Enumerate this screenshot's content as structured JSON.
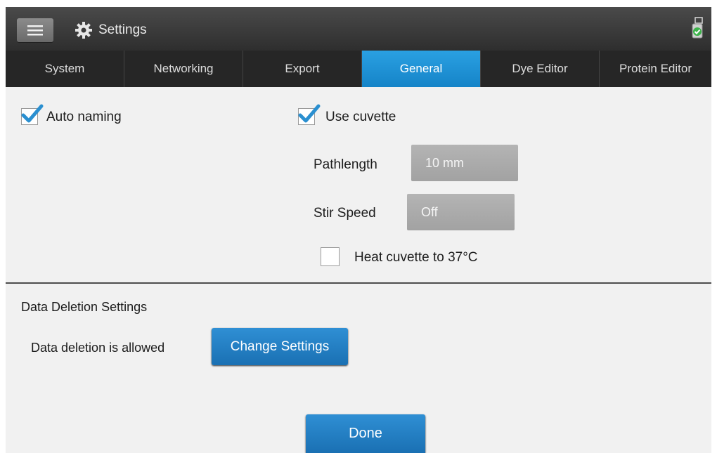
{
  "app": {
    "title": "Settings"
  },
  "tabs": [
    {
      "label": "System"
    },
    {
      "label": "Networking"
    },
    {
      "label": "Export"
    },
    {
      "label": "General",
      "active": true
    },
    {
      "label": "Dye Editor"
    },
    {
      "label": "Protein Editor"
    }
  ],
  "general": {
    "auto_naming": {
      "label": "Auto naming",
      "checked": true
    },
    "use_cuvette": {
      "label": "Use cuvette",
      "checked": true
    },
    "pathlength": {
      "label": "Pathlength",
      "value": "10 mm"
    },
    "stir_speed": {
      "label": "Stir Speed",
      "value": "Off"
    },
    "heat_cuvette": {
      "label": "Heat cuvette to 37°C",
      "checked": false
    }
  },
  "data_deletion": {
    "heading": "Data Deletion Settings",
    "status": "Data deletion is allowed",
    "change_button": "Change Settings"
  },
  "done_button": "Done",
  "colors": {
    "accent": "#1f86cc",
    "active_tab": "#1d8fd6",
    "check": "#2a8fd0"
  }
}
